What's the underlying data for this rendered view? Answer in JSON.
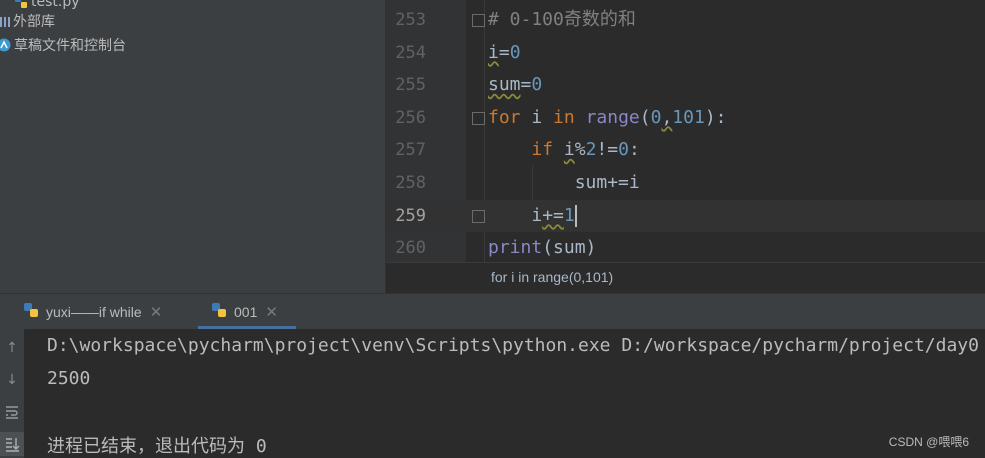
{
  "project": {
    "items": [
      {
        "label": "test.py",
        "icon": "python-file-icon"
      },
      {
        "label": "外部库",
        "icon": "library-icon"
      },
      {
        "label": "草稿文件和控制台",
        "icon": "scratches-icon"
      }
    ]
  },
  "editor": {
    "lines": [
      {
        "num": "253"
      },
      {
        "num": "254"
      },
      {
        "num": "255"
      },
      {
        "num": "256"
      },
      {
        "num": "257"
      },
      {
        "num": "258"
      },
      {
        "num": "259"
      },
      {
        "num": "260"
      }
    ],
    "tokens": {
      "comment": "# 0-100奇数的和",
      "i": "i",
      "eq": "=",
      "zero": "0",
      "sum": "sum",
      "for": "for",
      "in": "in",
      "range": "range",
      "lparen": "(",
      "comma": ",",
      "hundred_one": "101",
      "rparen_colon": "):",
      "if": "if",
      "mod": "%",
      "two": "2",
      "neq": "!=",
      "colon": ":",
      "plus_eq": "+=",
      "one": "1",
      "print": "print",
      "sum_paren": "(sum)"
    }
  },
  "breadcrumb": {
    "text": "for i in range(0,101)"
  },
  "run_tabs": [
    {
      "label": "yuxi——if  while",
      "active": false
    },
    {
      "label": "001",
      "active": true
    }
  ],
  "console": {
    "lines": [
      "D:\\workspace\\pycharm\\project\\venv\\Scripts\\python.exe D:/workspace/pycharm/project/day0",
      "2500",
      "",
      "进程已结束，退出代码为 0"
    ]
  },
  "watermark": "CSDN @喂喂6",
  "colors": {
    "keyword": "#cc7832",
    "number": "#6897bb",
    "comment": "#808080",
    "builtin": "#8888c6",
    "text": "#a9b7c6"
  }
}
